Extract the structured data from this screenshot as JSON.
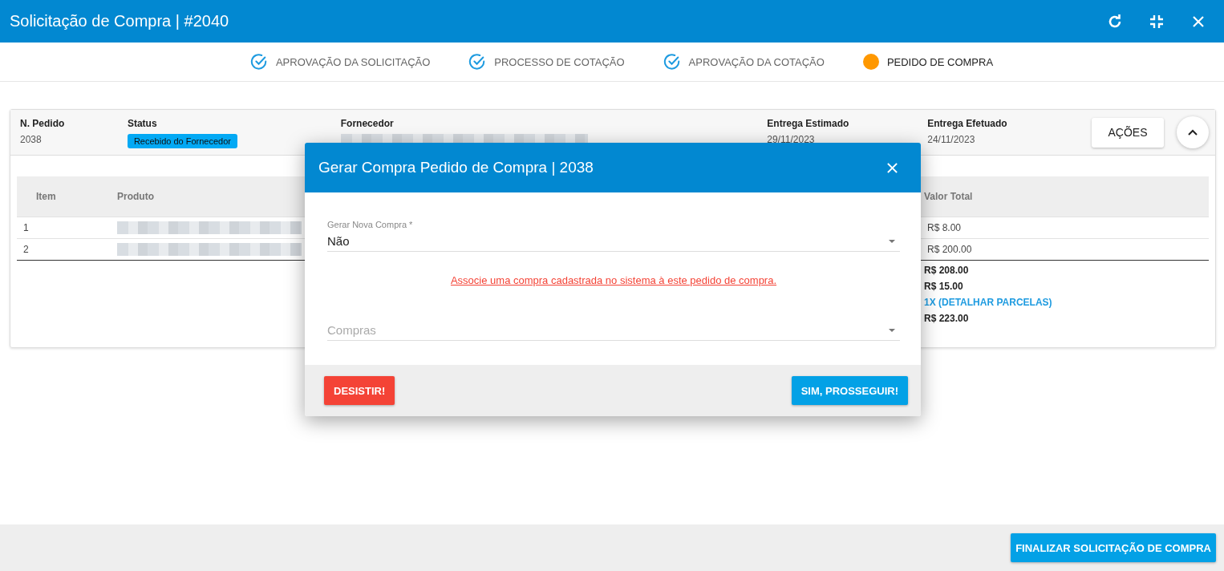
{
  "window": {
    "title": "Solicitação de Compra | #2040"
  },
  "steps": [
    {
      "label": "APROVAÇÃO DA SOLICITAÇÃO",
      "done": true
    },
    {
      "label": "PROCESSO DE COTAÇÃO",
      "done": true
    },
    {
      "label": "APROVAÇÃO DA COTAÇÃO",
      "done": true
    },
    {
      "label": "PEDIDO DE COMPRA",
      "done": false
    }
  ],
  "order": {
    "fields": [
      {
        "label": "N. Pedido",
        "value": "2038",
        "kind": "text"
      },
      {
        "label": "Status",
        "value": "Recebido do Fornecedor",
        "kind": "badge"
      },
      {
        "label": "Fornecedor",
        "kind": "redacted"
      },
      {
        "label": "Entrega Estimado",
        "value": "29/11/2023",
        "kind": "text"
      },
      {
        "label": "Entrega Efetuado",
        "value": "24/11/2023",
        "kind": "text"
      }
    ],
    "actions_button": "AÇÕES",
    "expanded": true
  },
  "table": {
    "columns": [
      "Item",
      "Produto",
      "Valor Total"
    ],
    "rows": [
      {
        "item": "1",
        "total": "R$ 8.00"
      },
      {
        "item": "2",
        "total": "R$ 200.00"
      }
    ],
    "totals": [
      {
        "value": "R$ 208.00",
        "kind": "text"
      },
      {
        "value": "R$ 15.00",
        "kind": "text"
      },
      {
        "value": "1X (DETALHAR PARCELAS)",
        "kind": "link"
      },
      {
        "value": "R$ 223.00",
        "kind": "text"
      }
    ]
  },
  "dialog": {
    "title": "Gerar Compra Pedido de Compra | 2038",
    "select_label": "Gerar Nova Compra *",
    "select_value": "Não",
    "warning": "Associe uma compra cadastrada no sistema à este pedido de compra.",
    "purchases_placeholder": "Compras",
    "cancel": "DESISTIR!",
    "confirm": "SIM, PROSSEGUIR!"
  },
  "footer_button": "FINALIZAR SOLICITAÇÃO DE COMPRA"
}
